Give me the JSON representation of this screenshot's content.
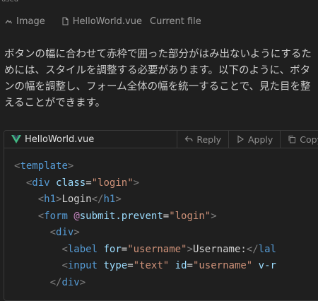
{
  "top_cut_text": "used",
  "references": [
    {
      "icon": "image-icon",
      "label": "Image"
    },
    {
      "icon": "file-icon",
      "label": "HelloWorld.vue",
      "sublabel": "Current file"
    }
  ],
  "paragraph": "ボタンの幅に合わせて赤枠で囲った部分がはみ出ないようにするためには、スタイルを調整する必要があります。以下のように、ボタンの幅を調整し、フォーム全体の幅を統一することで、見た目を整えることができます。",
  "code_block": {
    "filename": "HelloWorld.vue",
    "actions": {
      "reply": "Reply",
      "apply": "Apply",
      "copy": "Copy"
    },
    "tokens": {
      "lt": "<",
      "gt": ">",
      "lt_slash": "</",
      "eq": "=",
      "template": "template",
      "div": "div",
      "class_attr": "class",
      "login_str": "\"login\"",
      "h1": "h1",
      "login_text": "Login",
      "form": "form",
      "at": "@",
      "submit": "submit",
      "dot_prevent": ".prevent",
      "label": "label",
      "for_attr": "for",
      "username_str": "\"username\"",
      "username_text": "Username:",
      "lab_cut": "lal",
      "input": "input",
      "type_attr": "type",
      "text_str": "\"text\"",
      "id_attr": "id",
      "v_cut": "v-r"
    }
  }
}
